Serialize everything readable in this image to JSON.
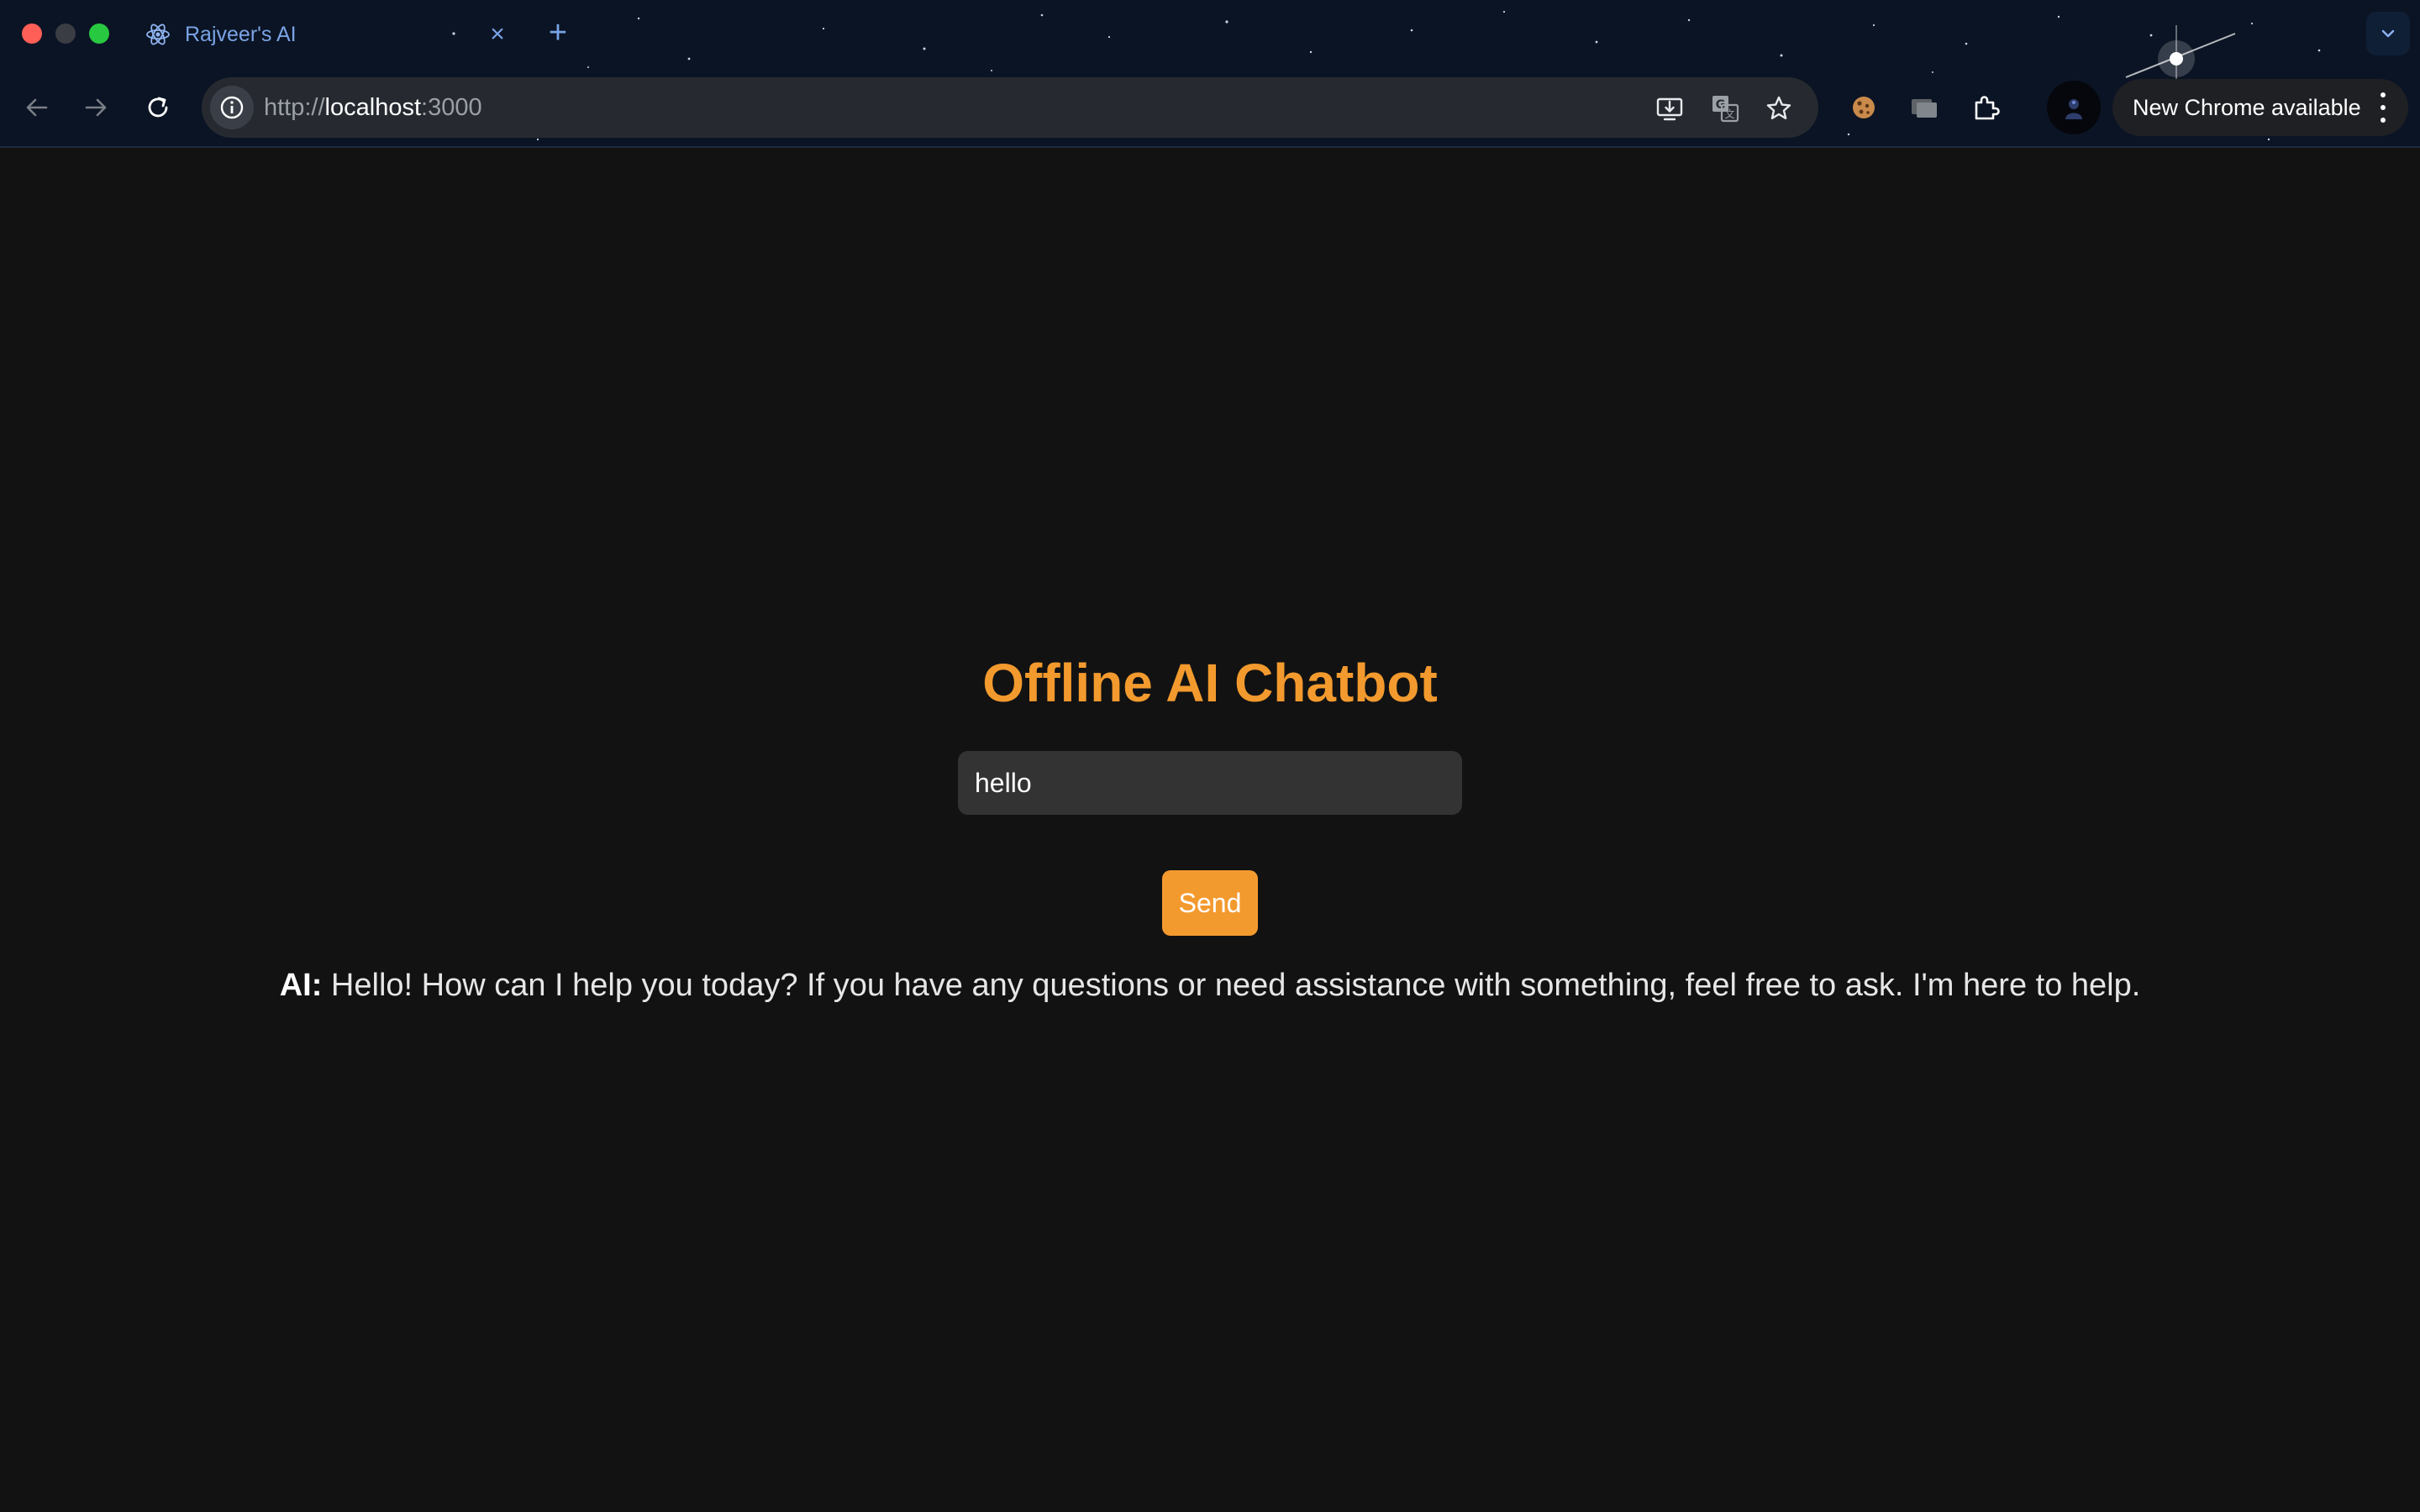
{
  "browser": {
    "tab_title": "Rajveer's AI",
    "url_scheme": "http://",
    "url_host": "localhost",
    "url_port": ":3000",
    "update_label": "New Chrome available",
    "icons": {
      "tab_favicon": "react-atom-icon",
      "back": "arrow-left-icon",
      "forward": "arrow-right-icon",
      "reload": "reload-icon",
      "site_info": "info-icon",
      "install": "install-app-icon",
      "translate": "translate-icon",
      "bookmark": "star-icon",
      "extensions": [
        "cookie-icon",
        "cards-icon",
        "puzzle-icon"
      ],
      "menu": "kebab-menu-icon"
    },
    "theme": {
      "tab_text": "#7aa3e6",
      "omnibox": "#262a30"
    }
  },
  "app": {
    "title": "Offline AI Chatbot",
    "input_value": "hello",
    "send_label": "Send",
    "response_speaker": "AI:",
    "response_text": "Hello! How can I help you today? If you have any questions or need assistance with something, feel free to ask. I'm here to help.",
    "colors": {
      "accent": "#f39a2e",
      "background": "#121212",
      "input_bg": "#333333"
    }
  }
}
